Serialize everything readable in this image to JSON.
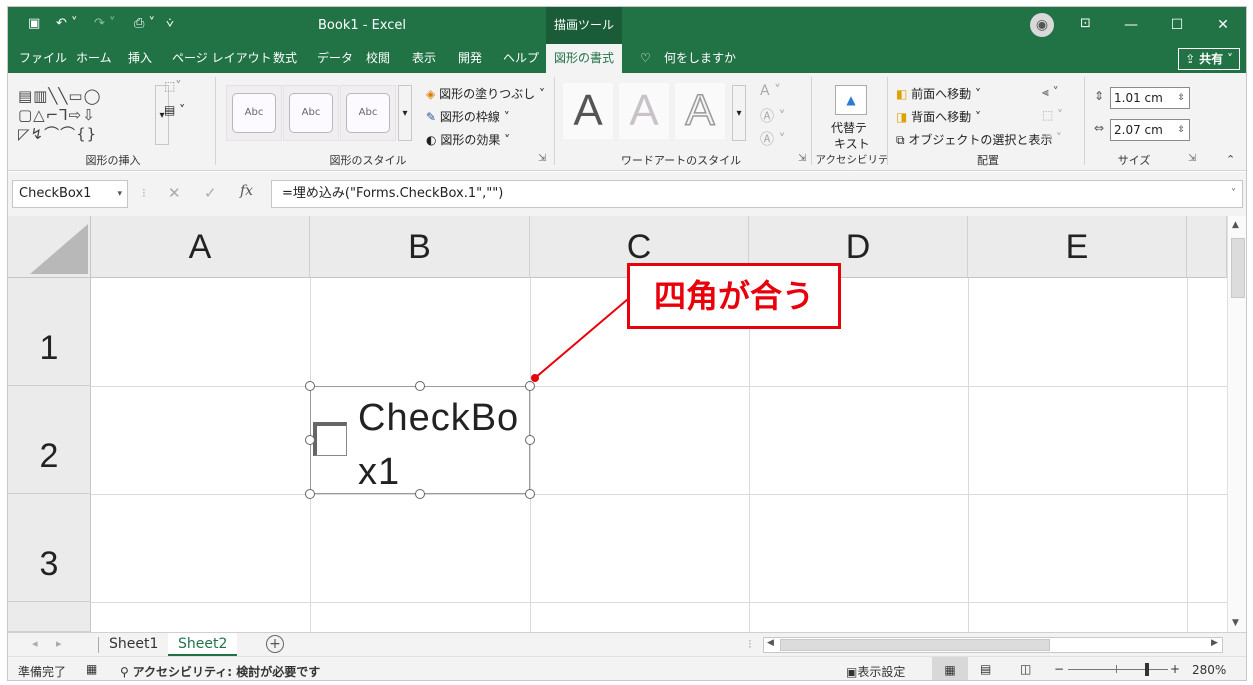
{
  "titlebar": {
    "title": "Book1  -  Excel",
    "context_tab_head": "描画ツール",
    "minimize": "—",
    "restore": "☐",
    "close": "✕"
  },
  "tabs": [
    {
      "label": "ファイル"
    },
    {
      "label": "ホーム"
    },
    {
      "label": "挿入"
    },
    {
      "label": "ページ レイアウト"
    },
    {
      "label": "数式"
    },
    {
      "label": "データ"
    },
    {
      "label": "校閲"
    },
    {
      "label": "表示"
    },
    {
      "label": "開発"
    },
    {
      "label": "ヘルプ"
    },
    {
      "label": "図形の書式",
      "active": true
    },
    {
      "label": "何をしますか"
    }
  ],
  "share_label": "共有",
  "ribbon": {
    "groups": {
      "insert_shapes": "図形の挿入",
      "shape_styles": "図形のスタイル",
      "wordart_styles": "ワードアートのスタイル",
      "accessibility": "アクセシビリティ",
      "arrange": "配置",
      "size": "サイズ"
    },
    "abc_label": "Abc",
    "shape_fill": "図形の塗りつぶし",
    "shape_outline": "図形の枠線",
    "shape_effects": "図形の効果",
    "wordart_letter": "A",
    "alt_text_line1": "代替テ",
    "alt_text_line2": "キスト",
    "bring_forward": "前面へ移動",
    "send_backward": "背面へ移動",
    "selection_pane": "オブジェクトの選択と表示",
    "height": "1.01 cm",
    "width": "2.07 cm"
  },
  "formula_bar": {
    "name_box": "CheckBox1",
    "fx": "fx",
    "formula": "=埋め込み(\"Forms.CheckBox.1\",\"\")"
  },
  "grid": {
    "columns": [
      "A",
      "B",
      "C",
      "D",
      "E"
    ],
    "rows": [
      "1",
      "2",
      "3"
    ]
  },
  "checkbox_object": {
    "line1": "CheckBo",
    "line2": "x1"
  },
  "callout": {
    "text": "四角が合う",
    "color": "#e8000b"
  },
  "sheets": [
    {
      "label": "Sheet1",
      "active": false
    },
    {
      "label": "Sheet2",
      "active": true
    }
  ],
  "status": {
    "ready": "準備完了",
    "accessibility": "アクセシビリティ: 検討が必要です",
    "display_settings": "表示設定",
    "zoom": "280%"
  },
  "colors": {
    "brand": "#217346",
    "accent_red": "#e8000b"
  }
}
